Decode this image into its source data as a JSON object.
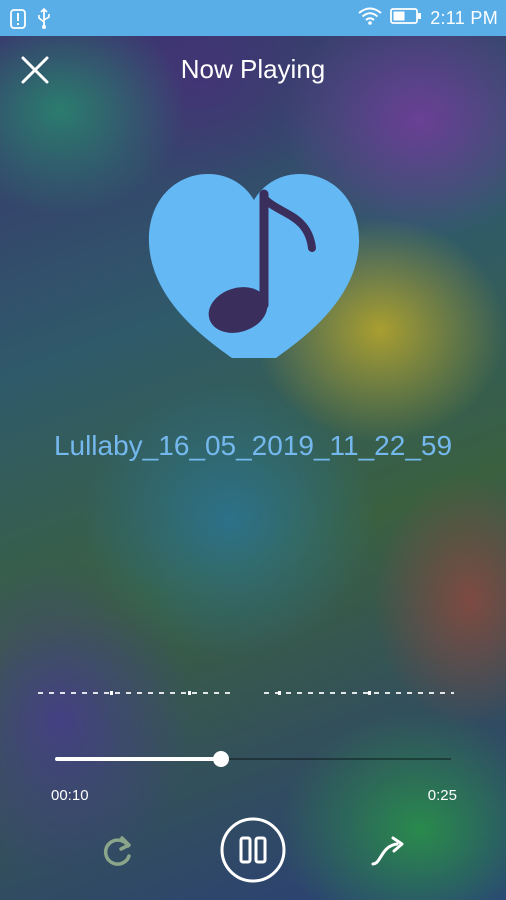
{
  "status_bar": {
    "time": "2:11 PM",
    "icons": [
      "alert-icon",
      "usb-icon",
      "wifi-icon",
      "battery-icon"
    ]
  },
  "header": {
    "title": "Now Playing",
    "close_icon": "close-icon"
  },
  "artwork": {
    "icon": "heart-music-note-icon",
    "color": "#64b8f4"
  },
  "track": {
    "title": "Lullaby_16_05_2019_11_22_59"
  },
  "player": {
    "elapsed": "00:10",
    "duration": "0:25",
    "progress": 0.42
  },
  "controls": {
    "repeat_icon": "repeat-icon",
    "pause_icon": "pause-icon",
    "share_icon": "share-icon"
  },
  "colors": {
    "status_bar": "#5aaee8",
    "accent": "#74b8ee",
    "disabled_icon": "#8aa58a"
  }
}
